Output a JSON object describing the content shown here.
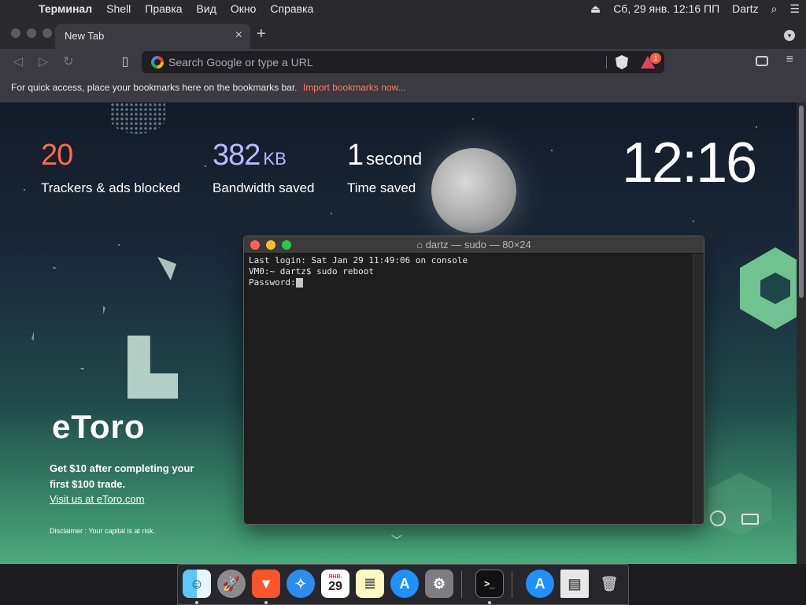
{
  "menubar": {
    "app": "Терминал",
    "items": [
      "Shell",
      "Правка",
      "Вид",
      "Окно",
      "Справка"
    ],
    "clock": "Сб, 29 янв.  12:16 ПП",
    "user": "Dartz"
  },
  "browser": {
    "tab_title": "New Tab",
    "omnibox_placeholder": "Search Google or type a URL",
    "rewards_badge": "1",
    "bookmarks_hint": "For quick access, place your bookmarks here on the bookmarks bar.",
    "bookmarks_import": "Import bookmarks now..."
  },
  "ntp": {
    "trackers": {
      "value": "20",
      "label": "Trackers & ads blocked",
      "color": "#ff6b4a"
    },
    "bandwidth": {
      "value": "382",
      "unit": "KB",
      "label": "Bandwidth saved",
      "color": "#b8b8ff"
    },
    "time": {
      "value": "1",
      "unit": "second",
      "label": "Time saved"
    },
    "clock": "12:16",
    "sponsor": {
      "logo": "eToro",
      "promo": "Get $10 after completing your first $100 trade.",
      "link": "Visit us at eToro.com",
      "disclaimer": "Disclaimer : Your capital is at risk."
    }
  },
  "terminal": {
    "title": "dartz — sudo — 80×24",
    "lines": [
      "Last login: Sat Jan 29 11:49:06 on console",
      "VM0:~ dartz$ sudo reboot",
      "Password:"
    ]
  },
  "dock": {
    "items": [
      "finder",
      "launchpad",
      "brave",
      "safari",
      "calendar",
      "notes",
      "app-store",
      "system-preferences",
      "terminal",
      "app-store-downloads",
      "document",
      "trash"
    ],
    "calendar_month": "ЯНВ.",
    "calendar_day": "29"
  },
  "colors": {
    "menubar": "#2a2a2c",
    "accent_link": "#ff7c61"
  }
}
